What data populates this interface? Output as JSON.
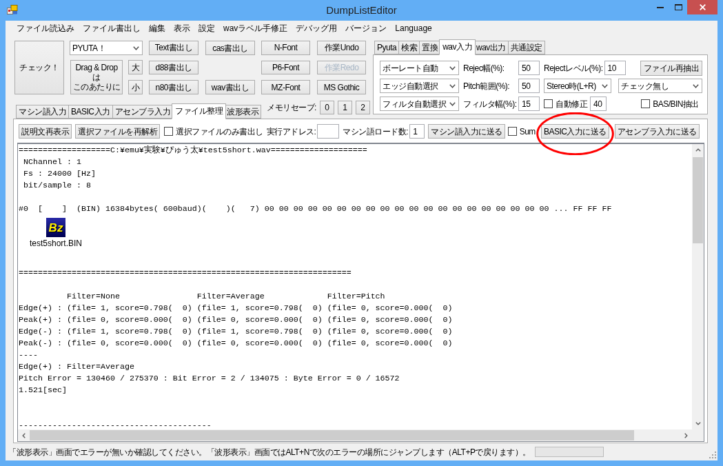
{
  "window": {
    "title": "DumpListEditor"
  },
  "menu": [
    "ファイル読込み",
    "ファイル書出し",
    "編集",
    "表示",
    "設定",
    "wavラベル手修正",
    "デバッグ用",
    "バージョン",
    "Language"
  ],
  "toolbar": {
    "check_button": "チェック！",
    "machine_select": "PYUTA！",
    "drop_area": [
      "Drag & Drop",
      "は",
      "このあたりに"
    ],
    "size_buttons": [
      "大",
      "小"
    ],
    "export_column_1": [
      "Text書出し",
      "d88書出し",
      "n80書出し"
    ],
    "export_column_2": {
      "top": "cas書出し",
      "bottom": "wav書出し"
    },
    "font_buttons": [
      "N-Font",
      "P6-Font",
      "MZ-Font"
    ],
    "edit_buttons": [
      {
        "label": "作業Undo",
        "disabled": false
      },
      {
        "label": "作業Redo",
        "disabled": true
      },
      {
        "label": "MS Gothic",
        "disabled": false
      }
    ]
  },
  "main_tabs": [
    {
      "label": "マシン語入力",
      "selected": false
    },
    {
      "label": "BASIC入力",
      "selected": false
    },
    {
      "label": "アセンブラ入力",
      "selected": false
    },
    {
      "label": "ファイル整理",
      "selected": true
    },
    {
      "label": "波形表示",
      "selected": false
    }
  ],
  "memory_save": {
    "label": "メモリセーブ:",
    "buttons": [
      "0",
      "1",
      "2"
    ]
  },
  "wav_panel": {
    "tabs": [
      {
        "label": "Pyuta",
        "selected": false
      },
      {
        "label": "検索",
        "selected": false
      },
      {
        "label": "置換",
        "selected": false
      },
      {
        "label": "wav入力",
        "selected": true
      },
      {
        "label": "wav出力",
        "selected": false
      },
      {
        "label": "共通設定",
        "selected": false
      }
    ],
    "baud_select": "ボーレート自動",
    "edge_select": "エッジ自動選択",
    "filter_select": "フィルタ自動選択",
    "reject_width": {
      "label": "Rejec幅(%):",
      "value": "50"
    },
    "pitch_range": {
      "label": "Pitch範囲(%):",
      "value": "50"
    },
    "filter_width": {
      "label": "フィルタ幅(%):",
      "value": "15"
    },
    "reject_level": {
      "label": "Rejectレベル(%):",
      "value": "10"
    },
    "stereo_select": "Stereo時(L+R)",
    "auto_fix": {
      "label": "自動修正",
      "checked": false,
      "value": "40"
    },
    "reextract_button": "ファイル再抽出",
    "check_select": "チェック無し",
    "bas_bin": {
      "label": "BAS/BIN抽出",
      "checked": false
    }
  },
  "file_panel": {
    "buttons": [
      "説明文再表示",
      "選択ファイルを再解析"
    ],
    "export_selected": {
      "label": "選択ファイルのみ書出し",
      "checked": false
    },
    "exec_address": {
      "label": "実行アドレス:"
    },
    "load_count": {
      "label": "マシン語ロード数:",
      "value": "1"
    },
    "send_machine": "マシン語入力に送る",
    "sum": {
      "label": "Sum",
      "checked": false
    },
    "send_basic": "BASIC入力に送る",
    "send_assembler": "アセンブラ入力に送る"
  },
  "output": [
    {
      "kind": "text",
      "text": "===================C:¥emu¥実験¥ぴゅう太¥test5short.wav===================="
    },
    {
      "kind": "text",
      "text": " NChannel : 1"
    },
    {
      "kind": "text",
      "text": " Fs : 24000 [Hz]"
    },
    {
      "kind": "text",
      "text": " bit/sample : 8"
    },
    {
      "kind": "blank"
    },
    {
      "kind": "text",
      "text": "#0  [    ]  (BIN) 16384bytes( 600baud)(    )(   7) 00 00 00 00 00 00 00 00 00 00 00 00 00 00 00 00 00 00 00 00 ... FF FF FF"
    },
    {
      "kind": "file",
      "icon_text": "Bz",
      "label": "test5short.BIN"
    },
    {
      "kind": "blank"
    },
    {
      "kind": "text",
      "text": "====================================================================="
    },
    {
      "kind": "blank"
    },
    {
      "kind": "text",
      "text": "          Filter=None                Filter=Average             Filter=Pitch"
    },
    {
      "kind": "text",
      "text": "Edge(+) : (file= 1, score=0.798(  0) (file= 1, score=0.798(  0) (file= 0, score=0.000(  0)"
    },
    {
      "kind": "text",
      "text": "Peak(+) : (file= 0, score=0.000(  0) (file= 0, score=0.000(  0) (file= 0, score=0.000(  0)"
    },
    {
      "kind": "text",
      "text": "Edge(-) : (file= 1, score=0.798(  0) (file= 1, score=0.798(  0) (file= 0, score=0.000(  0)"
    },
    {
      "kind": "text",
      "text": "Peak(-) : (file= 0, score=0.000(  0) (file= 0, score=0.000(  0) (file= 0, score=0.000(  0)"
    },
    {
      "kind": "text",
      "text": "----"
    },
    {
      "kind": "text",
      "text": "Edge(+) : Filter=Average"
    },
    {
      "kind": "text",
      "text": "Pitch Error = 130460 / 275370 : Bit Error = 2 / 134075 : Byte Error = 0 / 16572"
    },
    {
      "kind": "text",
      "text": "1.521[sec]"
    },
    {
      "kind": "blank"
    },
    {
      "kind": "blank"
    },
    {
      "kind": "text",
      "text": "----------------------------------------"
    }
  ],
  "status_bar": {
    "message": "「波形表示」画面でエラーが無いか確認してください。「波形表示」画面ではALT+Nで次のエラーの場所にジャンプします（ALT+Pで戻ります）。",
    "progress": {
      "level": 0
    }
  }
}
